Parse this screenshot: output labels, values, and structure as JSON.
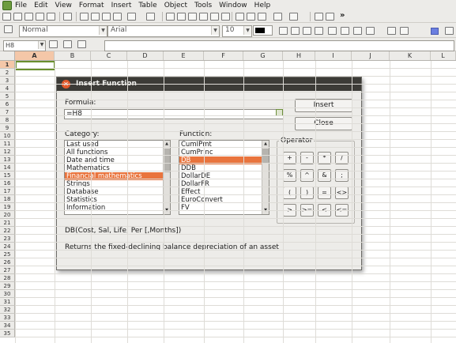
{
  "menubar": {
    "items": [
      "File",
      "Edit",
      "View",
      "Format",
      "Insert",
      "Table",
      "Object",
      "Tools",
      "Window",
      "Help"
    ]
  },
  "toolbar2": {
    "style": "Normal",
    "font": "Arial",
    "size": "10"
  },
  "namebox": {
    "value": "H8"
  },
  "columns": [
    "A",
    "B",
    "C",
    "D",
    "E",
    "F",
    "G",
    "H",
    "I",
    "J",
    "K",
    "L"
  ],
  "rows": [
    "1",
    "2",
    "3",
    "4",
    "5",
    "6",
    "7",
    "8",
    "9",
    "10",
    "11",
    "12",
    "13",
    "14",
    "15",
    "16",
    "17",
    "18",
    "19",
    "20",
    "21",
    "22",
    "23",
    "24",
    "25",
    "26",
    "27",
    "28",
    "29",
    "30",
    "31",
    "32",
    "33",
    "34",
    "35"
  ],
  "dialog": {
    "title": "Insert Function",
    "formula_label": "Formula:",
    "formula_value": "=H8",
    "insert_label": "Insert",
    "close_label": "Close",
    "category_label": "Category:",
    "categories": [
      "Last used",
      "All functions",
      "Date and time",
      "Mathematics",
      "Financial mathematics",
      "Strings",
      "Database",
      "Statistics",
      "Information"
    ],
    "selected_category": "Financial mathematics",
    "function_label": "Function:",
    "functions": [
      "CumIPmt",
      "CumPrinc",
      "DB",
      "DDB",
      "DollarDE",
      "DollarFR",
      "Effect",
      "EuroConvert",
      "FV"
    ],
    "selected_function": "DB",
    "operator_label": "Operator",
    "operators": [
      "+",
      "-",
      "*",
      "/",
      "%",
      "^",
      "&",
      ";",
      "(",
      ")",
      "=",
      "<>",
      ">",
      ">=",
      "<",
      "<="
    ],
    "syntax": "DB(Cost, Sal, Life, Per [,Months])",
    "description": "Returns the fixed-declining balance depreciation of an asset"
  },
  "colors": {
    "selection": "#e9743d",
    "titlebar": "#3c3b37",
    "close_button": "#e2582a"
  }
}
